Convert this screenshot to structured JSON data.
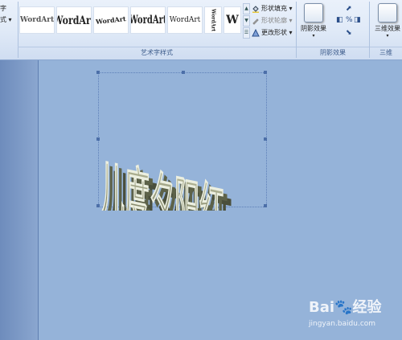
{
  "ribbon": {
    "left_stub": [
      "字",
      "式 ▾"
    ],
    "gallery": {
      "items": [
        "WordArt",
        "WordArt",
        "WordArt",
        "WordArt",
        "WordArt",
        "WordArt",
        "W"
      ],
      "scroll_up": "▲",
      "scroll_down": "▼",
      "more": "☰"
    },
    "shape_fill_label": "形状填充 ▾",
    "shape_outline_label": "形状轮廓 ▾",
    "change_shape_label": "更改形状 ▾",
    "wordart_group_label": "艺术字样式",
    "shadow_button_label": "阴影效果",
    "shadow_group_label": "阴影效果",
    "threed_button_label": "三维效果",
    "threed_group_label": "三维"
  },
  "document": {
    "wordart_text": "儿度夕阳红"
  },
  "watermark": {
    "logo_text": "Bai🐾经验",
    "url": "jingyan.baidu.com"
  },
  "colors": {
    "ribbon_bg": "#dfe9f7",
    "slide_bg": "#95b3d9",
    "wordart_face": "#a6aa8c",
    "wordart_side": "#4a4f3c"
  }
}
